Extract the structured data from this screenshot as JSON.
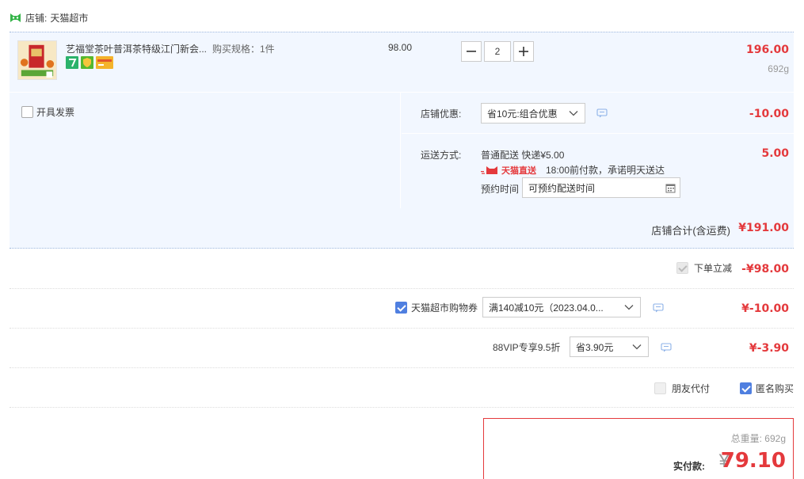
{
  "shop": {
    "label": "店铺:",
    "name": "天猫超市",
    "icon": "tmall-cat-icon"
  },
  "item": {
    "title": "艺福堂茶叶普洱茶特级江门新会...",
    "spec": "购买规格：1件",
    "unit_price": "98.00",
    "quantity": "2",
    "line_total": "196.00",
    "weight": "692g",
    "badges": [
      "seven-day-return-icon",
      "guarantee-icon",
      "card-icon"
    ]
  },
  "options": {
    "invoice_label": "开具发票",
    "shop_discount_label": "店铺优惠:",
    "shop_discount_value": "省10元:组合优惠",
    "shop_discount_amount": "-10.00",
    "shipping_label": "运送方式:",
    "shipping_method": "普通配送 快递¥5.00",
    "shipping_fee": "5.00",
    "tmall_direct_label": "天猫直送",
    "delivery_promise": "18:00前付款，承诺明天送达",
    "schedule_label": "预约时间",
    "schedule_placeholder": "可预约配送时间"
  },
  "shop_total": {
    "label": "店铺合计(含运费)",
    "value": "¥191.00"
  },
  "instant_discount": {
    "label": "下单立减",
    "value": "-¥98.00",
    "checked": true
  },
  "coupon": {
    "label": "天猫超市购物券",
    "value": "满140减10元（2023.04.0...",
    "amount": "¥-10.00",
    "checked": true
  },
  "vip": {
    "label": "88VIP专享9.5折",
    "value": "省3.90元",
    "amount": "¥-3.90"
  },
  "extra": {
    "friend_pay_label": "朋友代付",
    "anonymous_label": "匿名购买",
    "anonymous_checked": true
  },
  "summary": {
    "weight_label": "总重量:",
    "weight": "692g",
    "pay_label": "实付款:",
    "currency": "¥",
    "amount": "79.10"
  },
  "colors": {
    "accent_red": "#e4393c",
    "row_bg": "#f2f7ff",
    "checkbox_blue": "#4f7fe0"
  }
}
